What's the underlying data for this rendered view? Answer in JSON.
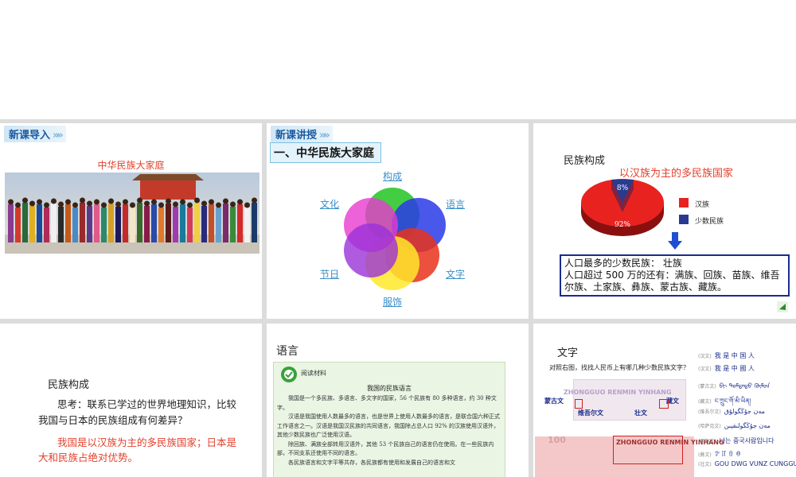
{
  "slide1": {
    "header": "新课导入",
    "title": "中华民族大家庭"
  },
  "slide2": {
    "header": "新课讲授",
    "section": "一、中华民族大家庭",
    "labels": {
      "top": "构成",
      "left": "文化",
      "right": "语言",
      "bottom_left": "节日",
      "bottom_right": "文字",
      "bottom": "服饰"
    }
  },
  "slide3": {
    "label": "民族构成",
    "subtitle": "以汉族为主的多民族国家",
    "pie_small_pct": "8%",
    "pie_large_pct": "92%",
    "legend": [
      {
        "label": "汉族",
        "color": "#e8231f"
      },
      {
        "label": "少数民族",
        "color": "#2a3a8f"
      }
    ],
    "info_line1": "人口最多的少数民族：   壮族",
    "info_line2": "人口超过 500 万的还有：满族、回族、苗族、维吾尔族、土家族、彝族、蒙古族、藏族。"
  },
  "slide4": {
    "label": "民族构成",
    "question": "思考：联系已学过的世界地理知识，比较我国与日本的民族组成有何差异？",
    "answer": "我国是以汉族为主的多民族国家；日本是大和民族占绝对优势。"
  },
  "slide5": {
    "label": "语言",
    "reading_head": "阅读材料",
    "reading_title": "我国的民族语言",
    "paragraphs": [
      "我国是一个多民族、多语言、多文字的国家，56 个民族有 80 多种语言，约 30 种文字。",
      "汉语是我国使用人数最多的语言，也是世界上使用人数最多的语言，是联合国六种正式工作语言之一。汉语是我国汉民族的共同语言，我国除占总人口 92% 的汉族使用汉语外，其他少数民族也广泛使用汉语。",
      "除回族、满族全部转用汉语外，其他 53 个民族自己的语言仍在使用。在一些民族内部，不同支系还使用不同的语言。",
      "各民族语言和文字平等共存，各民族都有使用和发展自己的语言和文"
    ]
  },
  "slide6": {
    "label": "文字",
    "question": "对照右图，找找人民币上有哪几种少数民族文字？",
    "note_top": "ZHONGGUO RENMIN YINHANG",
    "note_bottom": "ZHONGGUO RENMIN YINHANG",
    "note_value": "100",
    "ethnic_labels": [
      "蒙古文",
      "藏文",
      "维吾尔文",
      "壮文"
    ],
    "scripts": [
      {
        "tag": "(汉文)",
        "text": "我  是  中  国  人"
      },
      {
        "tag": "(汉文)",
        "text": "我  是  中  國  人"
      },
      {
        "tag": "(蒙古文)",
        "text": "ᠪᠢ ᠳᠤᠮᠳᠠᠳᠤ ᠬᠦᠮᠦᠨ"
      },
      {
        "tag": "(藏文)",
        "text": "ང་ཀྲུང་གོ་མི་ཡིན།"
      },
      {
        "tag": "(维吾尔文)",
        "text": "مەن جۇڭگولۇق"
      },
      {
        "tag": "(哈萨克文)",
        "text": "مەن جۇڭگولىقپىن"
      },
      {
        "tag": "(朝鲜文)",
        "text": "나는 중국사람입니다"
      },
      {
        "tag": "(彝文)",
        "text": "ꉢ ꍏ ꇩ ꊿ"
      },
      {
        "tag": "(壮文)",
        "text": "GOU DWG VUNZ CUNGGUEK"
      }
    ]
  },
  "colors": {
    "accent_red": "#e3402c",
    "header_blue": "#1a5aa0",
    "border_navy": "#1a2c8c"
  }
}
